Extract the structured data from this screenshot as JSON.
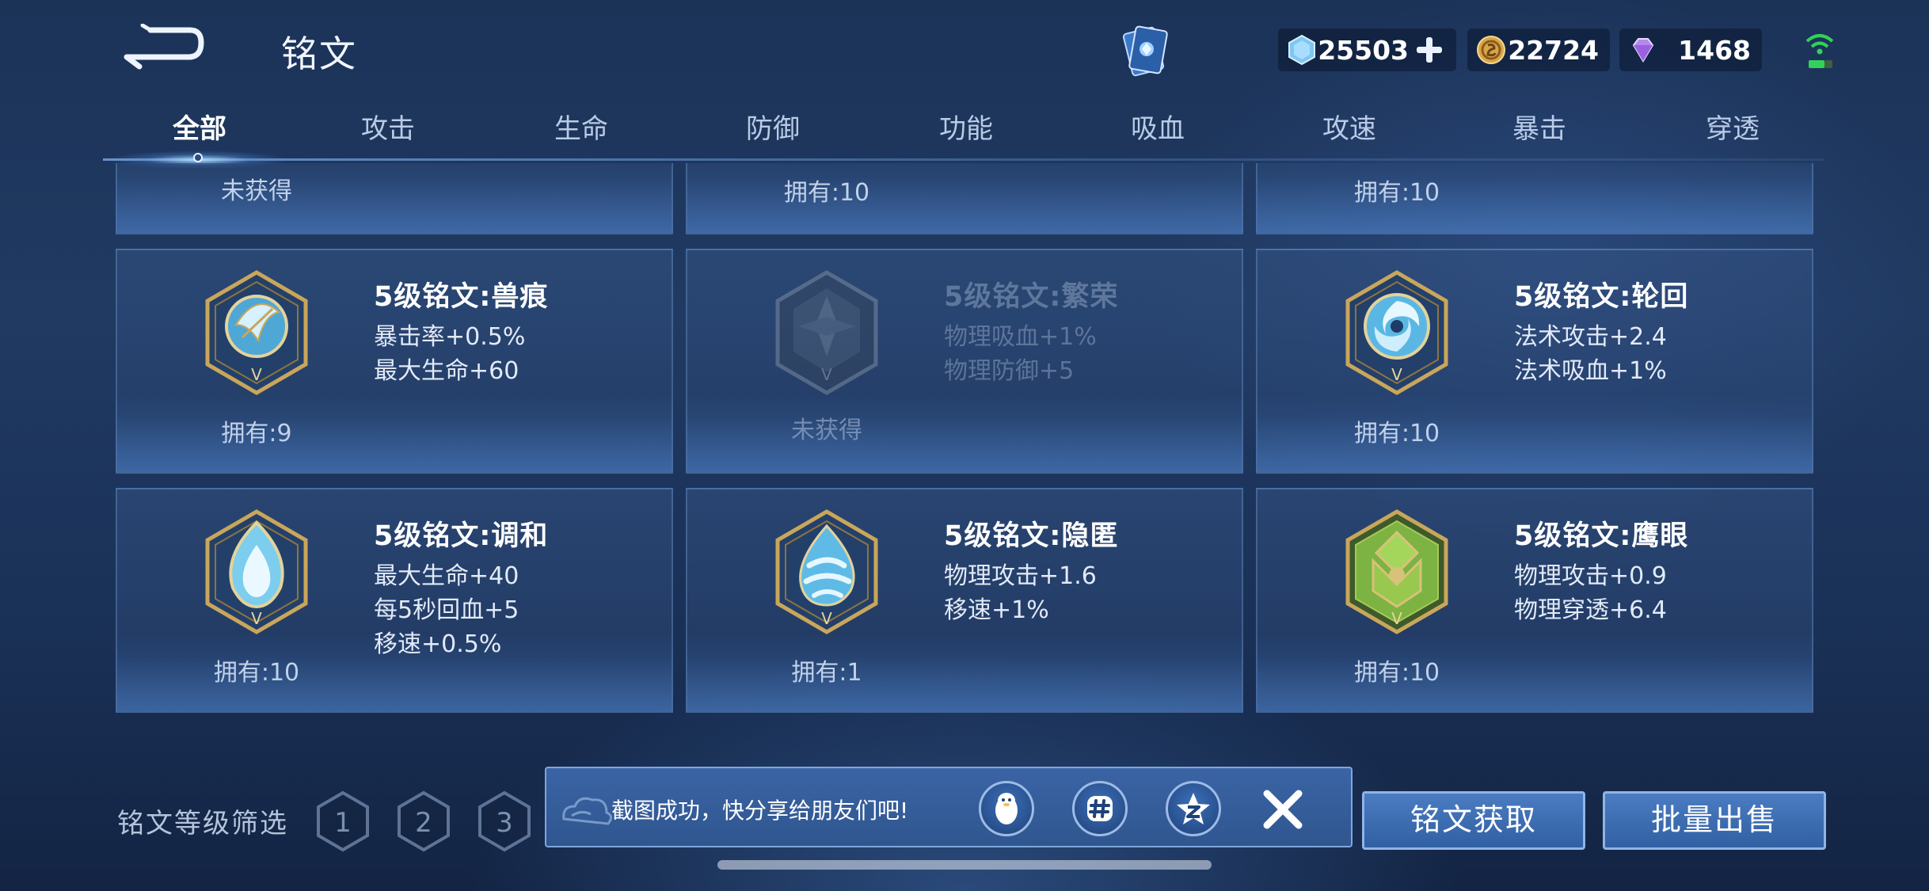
{
  "header": {
    "title": "铭文",
    "currencies": [
      {
        "id": "diamond",
        "value": "25503"
      },
      {
        "id": "gold",
        "value": "22724"
      },
      {
        "id": "gem",
        "value": "1468"
      }
    ]
  },
  "tabs": [
    {
      "label": "全部",
      "active": true
    },
    {
      "label": "攻击"
    },
    {
      "label": "生命"
    },
    {
      "label": "防御"
    },
    {
      "label": "功能"
    },
    {
      "label": "吸血"
    },
    {
      "label": "攻速"
    },
    {
      "label": "暴击"
    },
    {
      "label": "穿透"
    }
  ],
  "partial_row": [
    "未获得",
    "拥有:10",
    "拥有:10"
  ],
  "runes": [
    {
      "name": "5级铭文:兽痕",
      "stats": [
        "暴击率+0.5%",
        "最大生命+60"
      ],
      "owned": "拥有:9",
      "icon": "rune-shouhen-icon",
      "color": "#5fb6e0"
    },
    {
      "name": "5级铭文:繁荣",
      "stats": [
        "物理吸血+1%",
        "物理防御+5"
      ],
      "owned": "未获得",
      "icon": "rune-fanrong-icon",
      "color": "#7aa6c8",
      "dim": true
    },
    {
      "name": "5级铭文:轮回",
      "stats": [
        "法术攻击+2.4",
        "法术吸血+1%"
      ],
      "owned": "拥有:10",
      "icon": "rune-lunhui-icon",
      "color": "#6cc3ea"
    },
    {
      "name": "5级铭文:调和",
      "stats": [
        "最大生命+40",
        "每5秒回血+5",
        "移速+0.5%"
      ],
      "owned": "拥有:10",
      "icon": "rune-tiaohe-icon",
      "color": "#8fd6f2"
    },
    {
      "name": "5级铭文:隐匿",
      "stats": [
        "物理攻击+1.6",
        "移速+1%"
      ],
      "owned": "拥有:1",
      "icon": "rune-yinni-icon",
      "color": "#6cc6ea"
    },
    {
      "name": "5级铭文:鹰眼",
      "stats": [
        "物理攻击+0.9",
        "物理穿透+6.4"
      ],
      "owned": "拥有:10",
      "icon": "rune-yingyan-icon",
      "color": "#8cc34a"
    }
  ],
  "filter": {
    "label": "铭文等级筛选",
    "levels": [
      "1",
      "2",
      "3"
    ]
  },
  "toast": {
    "message": "截图成功，快分享给朋友们吧!"
  },
  "buttons": {
    "acquire": "铭文获取",
    "sell": "批量出售"
  },
  "colors": {
    "accent": "#3a66a8",
    "gold_frame": "#c9a65a",
    "text": "#ffffff"
  }
}
